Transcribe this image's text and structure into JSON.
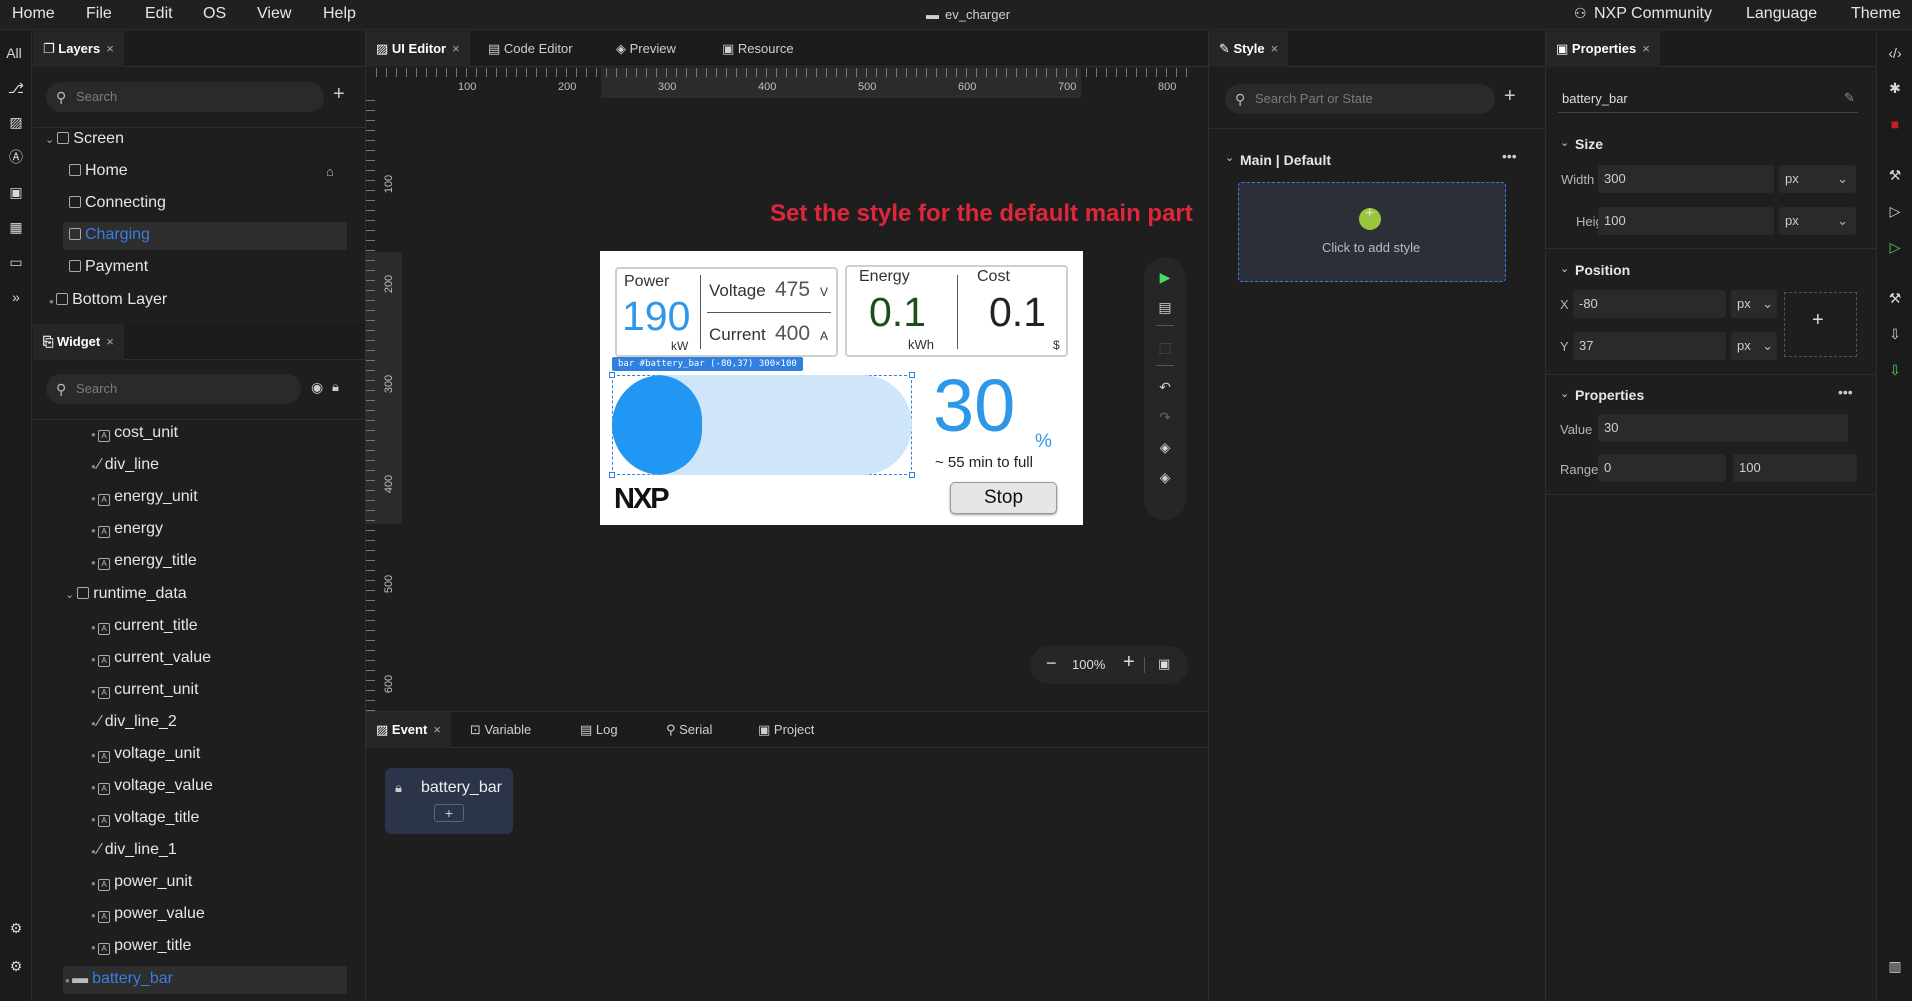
{
  "menu": {
    "home": "Home",
    "file": "File",
    "edit": "Edit",
    "os": "OS",
    "view": "View",
    "help": "Help",
    "title": "ev_charger",
    "community": "NXP Community",
    "language": "Language",
    "theme": "Theme"
  },
  "rail": {
    "all": "All"
  },
  "layers": {
    "tab": "Layers",
    "search_placeholder": "Search",
    "screen": "Screen",
    "home": "Home",
    "connecting": "Connecting",
    "charging": "Charging",
    "payment": "Payment",
    "bottom": "Bottom Layer"
  },
  "widget": {
    "tab": "Widget",
    "search_placeholder": "Search",
    "items": [
      "cost_unit",
      "div_line",
      "energy_unit",
      "energy",
      "energy_title"
    ],
    "group": "runtime_data",
    "group_items": [
      "current_title",
      "current_value",
      "current_unit",
      "div_line_2",
      "voltage_unit",
      "voltage_value",
      "voltage_title",
      "div_line_1",
      "power_unit",
      "power_value",
      "power_title"
    ],
    "selected": "battery_bar"
  },
  "editor_tabs": {
    "ui": "UI Editor",
    "code": "Code Editor",
    "preview": "Preview",
    "resource": "Resource"
  },
  "ruler": {
    "top": [
      "100",
      "200",
      "300",
      "400",
      "500",
      "600",
      "700",
      "800"
    ],
    "left": [
      "100",
      "200",
      "300",
      "400",
      "500",
      "600"
    ]
  },
  "hint": "Set the style for the default main part",
  "device": {
    "power_title": "Power",
    "power_value": "190",
    "power_unit": "kW",
    "voltage_title": "Voltage",
    "voltage_value": "475",
    "voltage_unit": "V",
    "current_title": "Current",
    "current_value": "400",
    "current_unit": "A",
    "energy_title": "Energy",
    "energy_value": "0.1",
    "energy_unit": "kWh",
    "cost_title": "Cost",
    "cost_value": "0.1",
    "cost_unit": "$",
    "bar_label": "bar #battery_bar (-80,37) 300×100",
    "percent": "30",
    "percent_sign": "%",
    "eta": "~ 55 min to full",
    "logo": "NXP",
    "stop": "Stop"
  },
  "zoom": {
    "level": "100%"
  },
  "bottom_tabs": {
    "event": "Event",
    "variable": "Variable",
    "log": "Log",
    "serial": "Serial",
    "project": "Project"
  },
  "event_card": {
    "name": "battery_bar",
    "add": "+"
  },
  "style": {
    "tab": "Style",
    "search_placeholder": "Search Part or State",
    "section": "Main | Default",
    "add_style": "Click to add style"
  },
  "properties": {
    "tab": "Properties",
    "name": "battery_bar",
    "size": "Size",
    "width_label": "Width",
    "width": "300",
    "height_label": "Height",
    "height": "100",
    "unit": "px",
    "position": "Position",
    "x_label": "X",
    "x": "-80",
    "y_label": "Y",
    "y": "37",
    "props": "Properties",
    "value_label": "Value",
    "value": "30",
    "range_label": "Range",
    "range_min": "0",
    "range_max": "100"
  },
  "colors": {
    "accent": "#2f97e8",
    "hint": "#e0263a",
    "bar_bg": "#cfe6fa",
    "bar_fill": "#2196f3",
    "green": "#4cd964"
  }
}
